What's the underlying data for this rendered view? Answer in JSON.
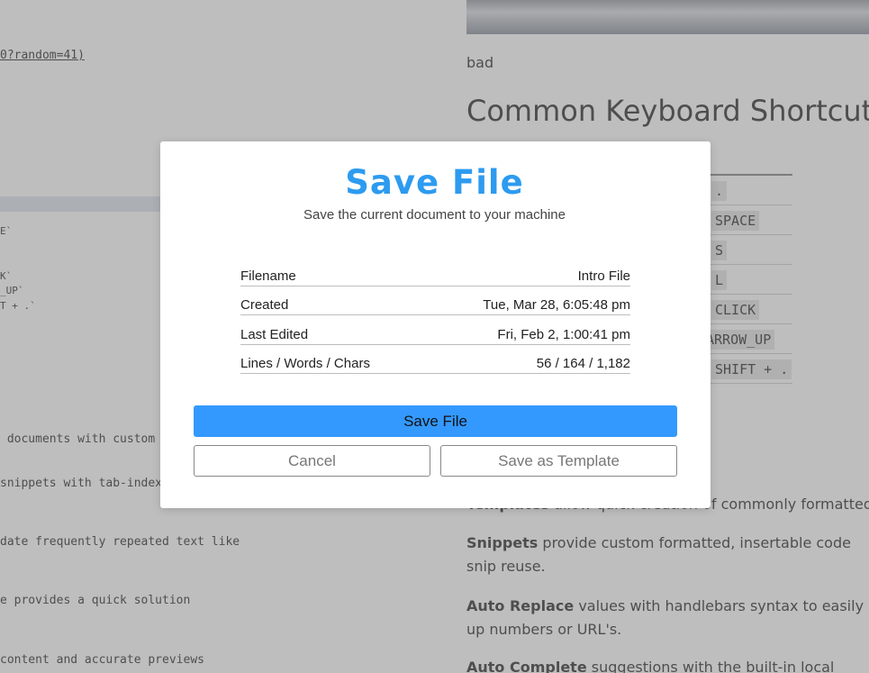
{
  "editor": {
    "lines": [
      "0?random=41)",
      "E`",
      "K`",
      "_UP`",
      "T + .`",
      " documents with custom f",
      "snippets with tab-indexe",
      "date frequently repeated text like",
      "e provides a quick solution",
      "content and accurate previews"
    ]
  },
  "preview": {
    "alt_text": "bad",
    "heading": "Common Keyboard Shortcuts",
    "shortcut_keys": [
      ".",
      "SPACE",
      "S",
      "L",
      "CLICK",
      "ARROW_UP",
      "SHIFT + ."
    ],
    "paragraphs": [
      {
        "bold": "Templates",
        "text": " allow quick creation of commonly formatted"
      },
      {
        "bold": "Snippets",
        "text": " provide custom formatted, insertable code snip reuse."
      },
      {
        "bold": "Auto Replace",
        "text": " values with handlebars syntax to easily up numbers or URL's."
      },
      {
        "bold": "Auto Complete",
        "text": " suggestions with the built-in local palett"
      }
    ]
  },
  "modal": {
    "title": "Save File",
    "subtitle": "Save the current document to your machine",
    "rows": [
      {
        "label": "Filename",
        "value": "Intro File"
      },
      {
        "label": "Created",
        "value": "Tue, Mar 28, 6:05:48 pm"
      },
      {
        "label": "Last Edited",
        "value": "Fri, Feb 2, 1:00:41 pm"
      },
      {
        "label": "Lines / Words / Chars",
        "value": "56 / 164 / 1,182"
      }
    ],
    "primary_button": "Save File",
    "cancel_button": "Cancel",
    "template_button": "Save as Template",
    "accent_color": "#3399ff"
  }
}
